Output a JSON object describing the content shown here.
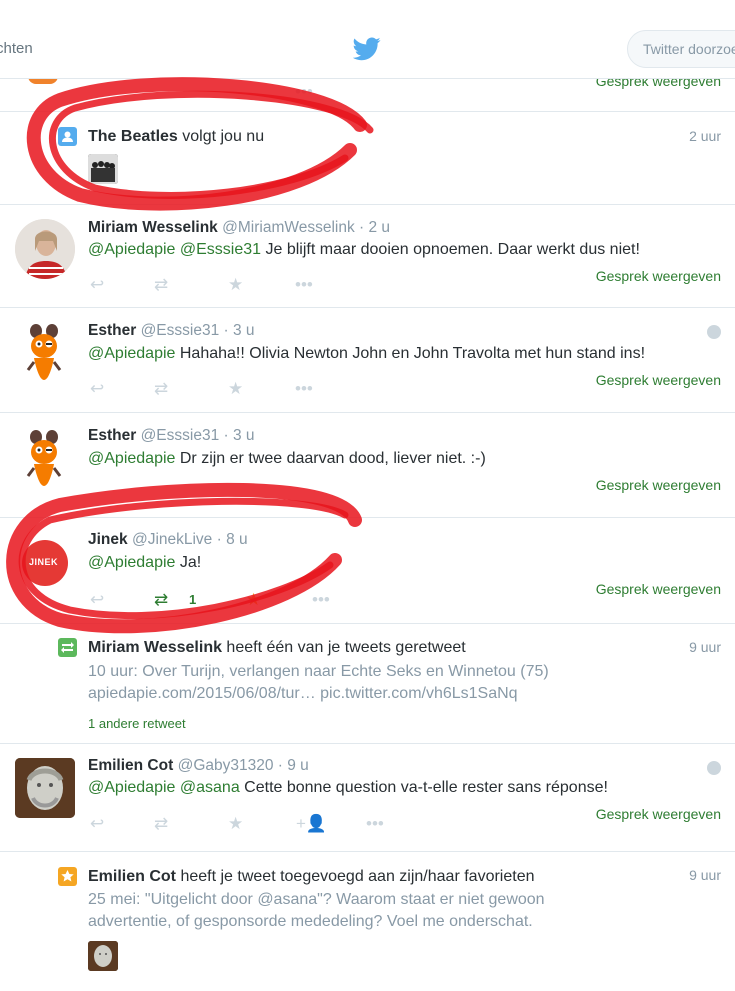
{
  "topbar": {
    "nav_label": "chten",
    "search_placeholder": "Twitter doorzoeken"
  },
  "top_partial": {
    "convo_label": "Gesprek weergeven"
  },
  "beatles": {
    "name": "The Beatles",
    "action": " volgt jou nu",
    "time": "2 uur"
  },
  "tweets": [
    {
      "name": "Miriam Wesselink",
      "handle": "@MiriamWesselink",
      "time": "· 2 u",
      "mentions": [
        "@Apiedapie",
        "@Esssie31"
      ],
      "text": " Je blijft maar dooien opnoemen. Daar werkt dus niet!",
      "convo": "Gesprek weergeven"
    },
    {
      "name": "Esther",
      "handle": "@Esssie31",
      "time": "· 3 u",
      "mentions": [
        "@Apiedapie"
      ],
      "text": " Hahaha!! Olivia Newton John en John Travolta met hun stand ins!",
      "convo": "Gesprek weergeven"
    },
    {
      "name": "Esther",
      "handle": "@Esssie31",
      "time": "· 3 u",
      "mentions": [
        "@Apiedapie"
      ],
      "text": " Dr zijn er twee daarvan dood, liever niet. :-)",
      "convo": "Gesprek weergeven"
    },
    {
      "name": "Jinek",
      "handle": "@JinekLive",
      "time": "· 8 u",
      "mentions": [
        "@Apiedapie"
      ],
      "text": " Ja!",
      "retweet_count": "1",
      "avatar_text": "JINEK",
      "convo": "Gesprek weergeven"
    },
    {
      "name": "Emilien Cot",
      "handle": "@Gaby31320",
      "time": "· 9 u",
      "mentions": [
        "@Apiedapie",
        "@asana"
      ],
      "text": " Cette bonne question va-t-elle rester sans réponse!",
      "convo": "Gesprek weergeven"
    }
  ],
  "retweet_notif": {
    "name": "Miriam Wesselink",
    "action": " heeft één van je tweets geretweet",
    "time": "9 uur",
    "line1": "10 uur: Over Turijn, verlangen naar Echte Seks en Winnetou (75)",
    "line2": "apiedapie.com/2015/06/08/tur… pic.twitter.com/vh6Ls1SaNq",
    "others": "1 andere retweet"
  },
  "fav_notif": {
    "name": "Emilien Cot",
    "action": " heeft je tweet toegevoegd aan zijn/haar favorieten",
    "time": "9 uur",
    "line1_pre": "25 mei: \"Uitgelicht door ",
    "line1_mention": "@asana",
    "line1_post": "\"? Waarom staat er niet gewoon",
    "line2": "advertentie, of gesponsorde mededeling? Voel me onderschat."
  },
  "icons": {
    "reply": "reply-icon",
    "retweet": "retweet-icon",
    "favorite": "star-icon",
    "more": "more-icon",
    "follow": "follow-icon",
    "globe": "globe-icon"
  },
  "colors": {
    "accent_green": "#2e7d32",
    "twitter_blue": "#55acee",
    "scribble_red": "#e8141c",
    "fav_orange": "#f5a623",
    "follow_blue": "#55acee",
    "retweet_green": "#5cb85c"
  }
}
